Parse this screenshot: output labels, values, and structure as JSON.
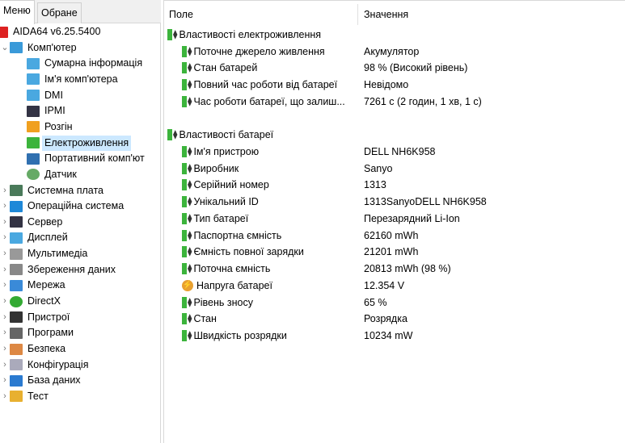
{
  "tabs": [
    "Меню",
    "Обране"
  ],
  "tree": [
    {
      "label": "AIDA64 v6.25.5400",
      "icon": "aida64-logo-icon",
      "level": 0,
      "chev": ""
    },
    {
      "label": "Комп'ютер",
      "icon": "computer-icon",
      "level": 0,
      "chev": "⌄"
    },
    {
      "label": "Сумарна інформація",
      "icon": "monitor-icon",
      "level": 1
    },
    {
      "label": "Ім'я комп'ютера",
      "icon": "monitor-icon",
      "level": 1
    },
    {
      "label": "DMI",
      "icon": "monitor-icon",
      "level": 1
    },
    {
      "label": "IPMI",
      "icon": "server-icon",
      "level": 1
    },
    {
      "label": "Розгін",
      "icon": "flame-icon",
      "level": 1
    },
    {
      "label": "Електроживлення",
      "icon": "battery-plug-icon",
      "level": 1,
      "selected": true
    },
    {
      "label": "Портативний комп'ют",
      "icon": "laptop-icon",
      "level": 1
    },
    {
      "label": "Датчик",
      "icon": "gauge-icon",
      "level": 1
    },
    {
      "label": "Системна плата",
      "icon": "motherboard-icon",
      "level": 0,
      "chev": "›"
    },
    {
      "label": "Операційна система",
      "icon": "windows-icon",
      "level": 0,
      "chev": "›"
    },
    {
      "label": "Сервер",
      "icon": "server-icon",
      "level": 0,
      "chev": "›"
    },
    {
      "label": "Дисплей",
      "icon": "monitor-icon",
      "level": 0,
      "chev": "›"
    },
    {
      "label": "Мультимедіа",
      "icon": "speaker-icon",
      "level": 0,
      "chev": "›"
    },
    {
      "label": "Збереження даних",
      "icon": "hard-drive-icon",
      "level": 0,
      "chev": "›"
    },
    {
      "label": "Мережа",
      "icon": "network-icon",
      "level": 0,
      "chev": "›"
    },
    {
      "label": "DirectX",
      "icon": "xbox-icon",
      "level": 0,
      "chev": "›"
    },
    {
      "label": "Пристрої",
      "icon": "device-icon",
      "level": 0,
      "chev": "›"
    },
    {
      "label": "Програми",
      "icon": "programs-icon",
      "level": 0,
      "chev": "›"
    },
    {
      "label": "Безпека",
      "icon": "shield-icon",
      "level": 0,
      "chev": "›"
    },
    {
      "label": "Конфігурація",
      "icon": "config-icon",
      "level": 0,
      "chev": "›"
    },
    {
      "label": "База даних",
      "icon": "database-icon",
      "level": 0,
      "chev": "›"
    },
    {
      "label": "Тест",
      "icon": "test-icon",
      "level": 0,
      "chev": "›"
    }
  ],
  "header": {
    "field": "Поле",
    "value": "Значення"
  },
  "groups": [
    {
      "title": "Властивості електроживлення",
      "rows": [
        {
          "field": "Поточне джерело живлення",
          "value": "Акумулятор"
        },
        {
          "field": "Стан батарей",
          "value": "98 % (Високий рівень)"
        },
        {
          "field": "Повний час роботи від батареї",
          "value": "Невідомо"
        },
        {
          "field": "Час роботи батареї, що залиш...",
          "value": "7261 с (2 годин, 1 хв, 1 с)"
        }
      ]
    },
    {
      "title": "Властивості батареї",
      "rows": [
        {
          "field": "Ім'я пристрою",
          "value": "DELL NH6K958"
        },
        {
          "field": "Виробник",
          "value": "Sanyo"
        },
        {
          "field": "Серійний номер",
          "value": "1313"
        },
        {
          "field": "Унікальний ID",
          "value": "1313SanyoDELL NH6K958"
        },
        {
          "field": "Тип батареї",
          "value": "Перезарядний Li-Ion"
        },
        {
          "field": "Паспортна ємність",
          "value": "62160 mWh"
        },
        {
          "field": "Ємність повної зарядки",
          "value": "21201 mWh"
        },
        {
          "field": "Поточна ємність",
          "value": "20813 mWh  (98 %)"
        },
        {
          "field": "Напруга батареї",
          "value": "12.354 V",
          "icon": "voltage-icon"
        },
        {
          "field": "Рівень зносу",
          "value": "65 %"
        },
        {
          "field": "Стан",
          "value": "Розрядка"
        },
        {
          "field": "Швидкість розрядки",
          "value": "10234 mW"
        }
      ]
    }
  ]
}
